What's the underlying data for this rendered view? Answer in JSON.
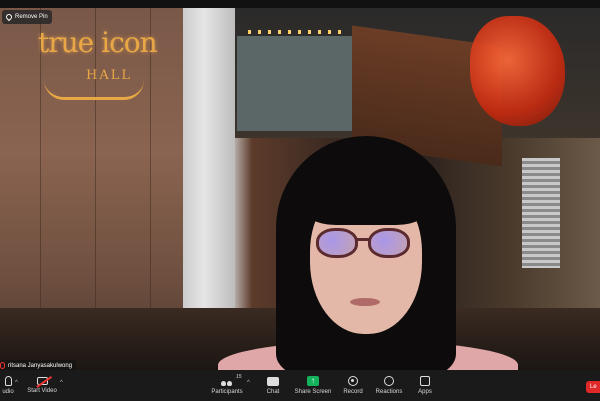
{
  "overlay": {
    "remove_pin": "Remove Pin",
    "name_tag": "ritsana Janyasakulwong"
  },
  "venue_sign": {
    "title": "true icon",
    "subtitle": "HALL"
  },
  "toolbar": {
    "audio_label": "udio",
    "video_label": "Start Video",
    "participants_label": "Participants",
    "participants_count": "15",
    "chat_label": "Chat",
    "share_label": "Share Screen",
    "record_label": "Record",
    "reactions_label": "Reactions",
    "apps_label": "Apps",
    "leave_label": "Le"
  },
  "colors": {
    "share_accent": "#14b25a",
    "leave": "#e02828",
    "muted": "#e33333"
  }
}
